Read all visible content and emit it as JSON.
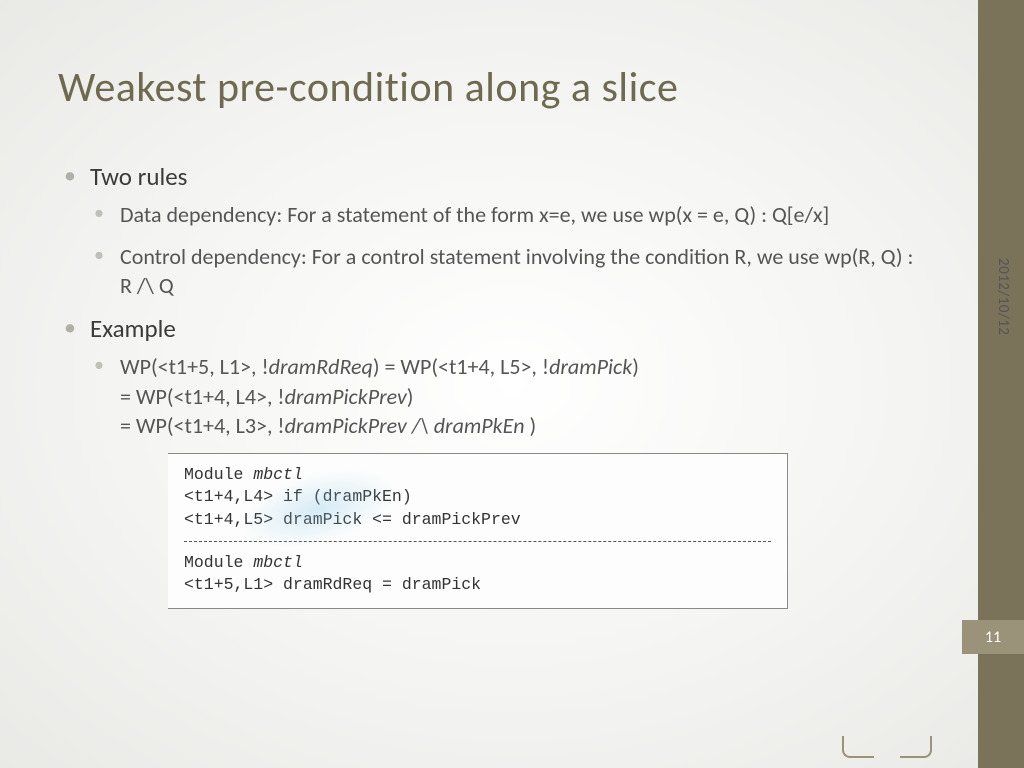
{
  "meta": {
    "date": "2012/10/12",
    "page": "11"
  },
  "title": "Weakest pre-condition along a slice",
  "bullets": {
    "rules_label": "Two rules",
    "rule_data": "Data dependency: For a statement of the form x=e, we use wp(x = e, Q) : Q[e/x]",
    "rule_ctrl": "Control dependency: For a control statement involving the condition R, we use wp(R, Q) : R /\\ Q",
    "example_label": "Example",
    "wp_line1_a": "WP(<t1+5, L1>, !",
    "wp_line1_b": "dramRdReq",
    "wp_line1_c": ") = WP(<t1+4, L5>, !",
    "wp_line1_d": "dramPick",
    "wp_line1_e": ")",
    "wp_line2_a": "= WP(<t1+4, L4>, !",
    "wp_line2_b": "dramPickPrev",
    "wp_line2_c": ")",
    "wp_line3_a": "= WP(<t1+4, L3>, !",
    "wp_line3_b": "dramPickPrev /\\ dramPkEn",
    "wp_line3_c": " )"
  },
  "code": {
    "l1": "Module  ",
    "l1i": "mbctl",
    "l2": "<t1+4,L4> if (dramPkEn)",
    "l3": "<t1+4,L5>    dramPick <= dramPickPrev",
    "l4": "Module  ",
    "l4i": "mbctl",
    "l5": "<t1+5,L1> dramRdReq = dramPick"
  }
}
